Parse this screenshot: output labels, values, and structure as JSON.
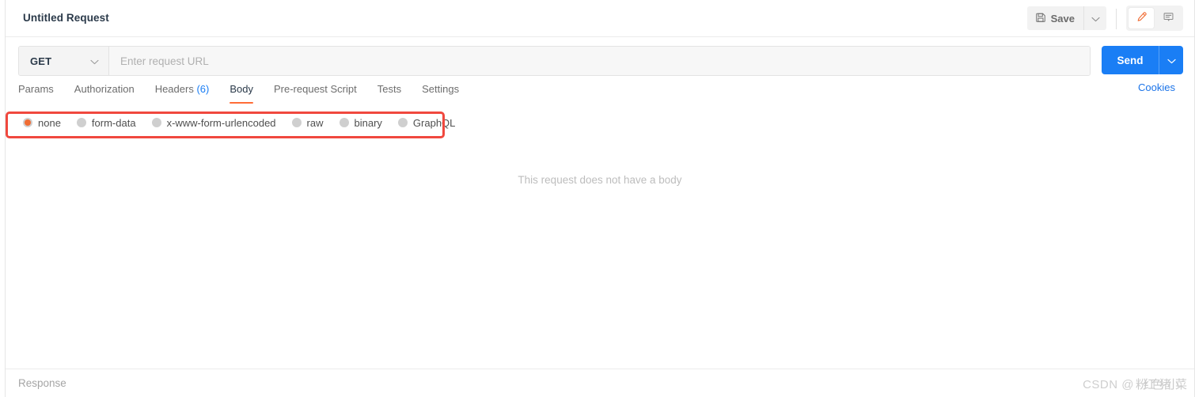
{
  "header": {
    "request_title": "Untitled Request",
    "save_label": "Save",
    "save_icon": "floppy-disk-icon",
    "save_caret_icon": "chevron-down-icon",
    "edit_icon": "pencil-icon",
    "comment_icon": "comment-icon"
  },
  "url_bar": {
    "method": "GET",
    "method_caret_icon": "chevron-down-icon",
    "url_value": "",
    "url_placeholder": "Enter request URL",
    "send_label": "Send",
    "send_caret_icon": "chevron-down-icon"
  },
  "tabs": {
    "items": [
      {
        "label": "Params",
        "active": false
      },
      {
        "label": "Authorization",
        "active": false
      },
      {
        "label": "Headers",
        "count": "(6)",
        "active": false
      },
      {
        "label": "Body",
        "active": true
      },
      {
        "label": "Pre-request Script",
        "active": false
      },
      {
        "label": "Tests",
        "active": false
      },
      {
        "label": "Settings",
        "active": false
      }
    ],
    "cookies_label": "Cookies"
  },
  "body_types": {
    "options": [
      {
        "label": "none",
        "selected": true
      },
      {
        "label": "form-data",
        "selected": false
      },
      {
        "label": "x-www-form-urlencoded",
        "selected": false
      },
      {
        "label": "raw",
        "selected": false
      },
      {
        "label": "binary",
        "selected": false
      },
      {
        "label": "GraphQL",
        "selected": false
      }
    ]
  },
  "body_area": {
    "empty_message": "This request does not have a body"
  },
  "footer": {
    "response_label": "Response",
    "watermark_prefix": "CSDN @",
    "watermark_user": "粉红色猪小菜"
  },
  "colors": {
    "accent_orange": "#ff6c37",
    "send_blue": "#1a7ef5",
    "link_blue": "#1a73e8",
    "annotation_red": "#f0483e"
  }
}
